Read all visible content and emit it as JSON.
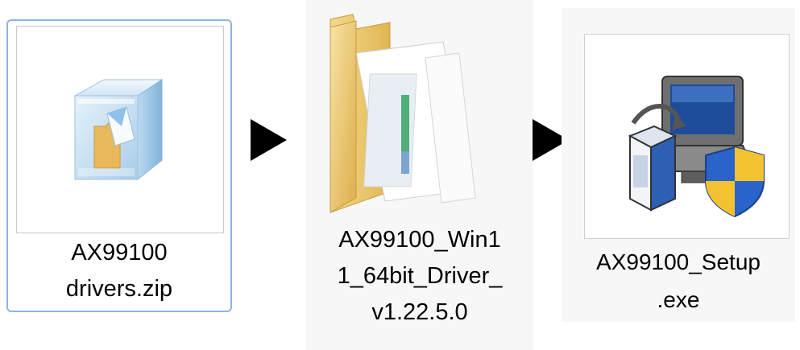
{
  "files": [
    {
      "name": "AX99100\ndrivers.zip",
      "icon": "zip-archive-icon"
    },
    {
      "name": "AX99100_Win1\n1_64bit_Driver_\nv1.22.5.0",
      "icon": "folder-icon"
    },
    {
      "name": "AX99100_Setup\n.exe",
      "icon": "setup-installer-icon"
    }
  ],
  "arrows": [
    "play-arrow-icon",
    "play-arrow-icon"
  ],
  "colors": {
    "selection_border": "#8fb5e0",
    "arrow": "#000000",
    "folder": "#e9c56a",
    "shield_blue": "#2a63c9",
    "shield_yellow": "#f2c230"
  }
}
